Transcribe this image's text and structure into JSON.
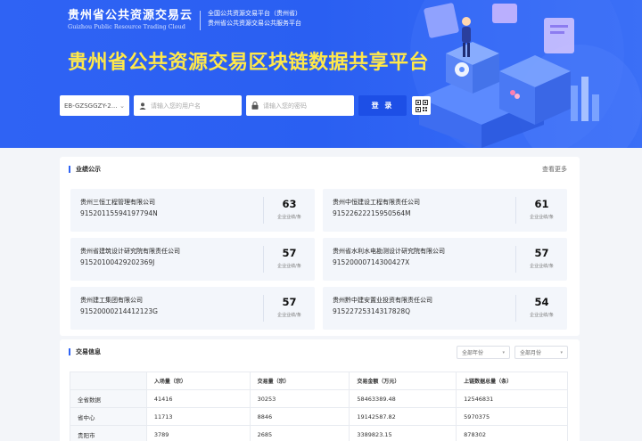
{
  "header": {
    "logo_cn": "贵州省公共资源交易云",
    "logo_en": "Guizhou Public Resource Trading Cloud",
    "logo_sub1": "全国公共资源交易平台（贵州省）",
    "logo_sub2": "贵州省公共资源交易公共服务平台",
    "title": "贵州省公共资源交易区块链数据共享平台"
  },
  "login": {
    "select_value": "EB-GZSGGZY-2...",
    "username_placeholder": "请输入您的用户名",
    "password_placeholder": "请输入您的密码",
    "login_label": "登 录",
    "qr_icon": "qr-code-icon"
  },
  "credit": {
    "title": "业绩公示",
    "more_label": "查看更多",
    "unit_label": "企业业绩/条",
    "companies": [
      {
        "name": "贵州三恒工程管理有限公司",
        "code": "91520115594197794N",
        "count": "63"
      },
      {
        "name": "贵州中恒建设工程有限责任公司",
        "code": "91522622215950564M",
        "count": "61"
      },
      {
        "name": "贵州省建筑设计研究院有限责任公司",
        "code": "91520100429202369J",
        "count": "57"
      },
      {
        "name": "贵州省水利水电勘测设计研究院有限公司",
        "code": "91520000714300427X",
        "count": "57"
      },
      {
        "name": "贵州建工集团有限公司",
        "code": "91520000214412123G",
        "count": "57"
      },
      {
        "name": "贵州黔中建安置业投资有限责任公司",
        "code": "91522725314317828Q",
        "count": "54"
      }
    ]
  },
  "trade": {
    "title": "交易信息",
    "filter_year": "全部年份",
    "filter_month": "全部月份",
    "columns": [
      "",
      "入场量（宗）",
      "交易量（宗）",
      "交易金额（万元）",
      "上链数据总量（条）"
    ],
    "rows": [
      [
        "全省数据",
        "41416",
        "30253",
        "58463389.48",
        "12546831"
      ],
      [
        "省中心",
        "11713",
        "8846",
        "19142587.82",
        "5970375"
      ],
      [
        "贵阳市",
        "3789",
        "2685",
        "3389823.15",
        "878302"
      ]
    ]
  },
  "colors": {
    "hero_blue": "#2f63f4",
    "title_yellow": "#ffe84a",
    "button_blue": "#1d4fe6"
  }
}
